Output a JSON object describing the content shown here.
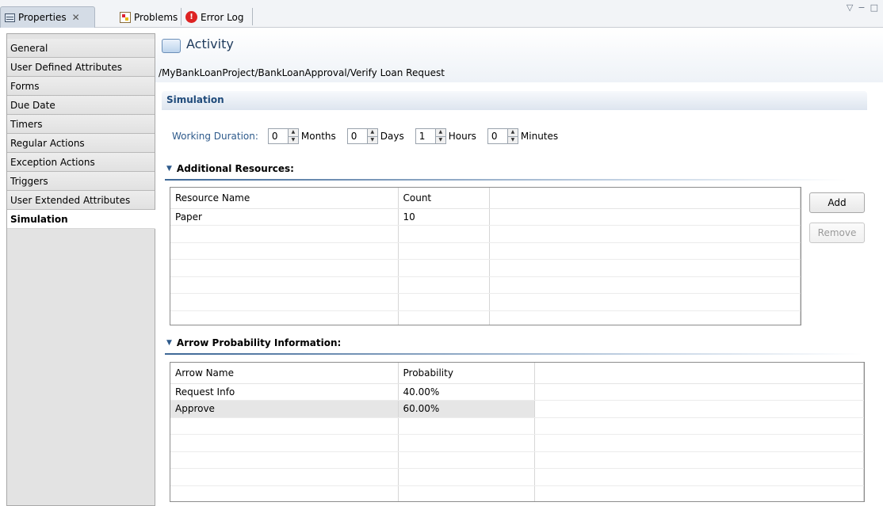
{
  "tabs": [
    {
      "label": "Properties",
      "close": "✕",
      "icon": "properties-icon"
    },
    {
      "label": "Problems",
      "icon": "problems-icon"
    },
    {
      "label": "Error Log",
      "icon": "error-log-icon"
    }
  ],
  "view_controls": {
    "menu": "▽",
    "minimize": "−",
    "maximize": "□"
  },
  "nav": [
    "General",
    "User Defined Attributes",
    "Forms",
    "Due Date",
    "Timers",
    "Regular Actions",
    "Exception Actions",
    "Triggers",
    "User Extended Attributes",
    "Simulation"
  ],
  "nav_selected": "Simulation",
  "header": {
    "title": "Activity",
    "path": "/MyBankLoanProject/BankLoanApproval/Verify Loan Request"
  },
  "section": {
    "title": "Simulation"
  },
  "working_duration": {
    "label": "Working Duration:",
    "months": {
      "value": "0",
      "unit": "Months"
    },
    "days": {
      "value": "0",
      "unit": "Days"
    },
    "hours": {
      "value": "1",
      "unit": "Hours"
    },
    "minutes": {
      "value": "0",
      "unit": "Minutes"
    }
  },
  "resources": {
    "heading": "Additional Resources:",
    "columns": [
      "Resource Name",
      "Count",
      ""
    ],
    "rows": [
      [
        "Paper",
        "10",
        ""
      ]
    ],
    "add_label": "Add",
    "remove_label": "Remove"
  },
  "arrows": {
    "heading": "Arrow Probability Information:",
    "columns": [
      "Arrow Name",
      "Probability",
      ""
    ],
    "rows": [
      [
        "Request Info",
        "40.00%",
        ""
      ],
      [
        "Approve",
        "60.00%",
        ""
      ]
    ]
  },
  "colors": {
    "accent": "#2e5a8b",
    "title": "#1f3b5c",
    "selected_row": "#e6e6e6"
  }
}
